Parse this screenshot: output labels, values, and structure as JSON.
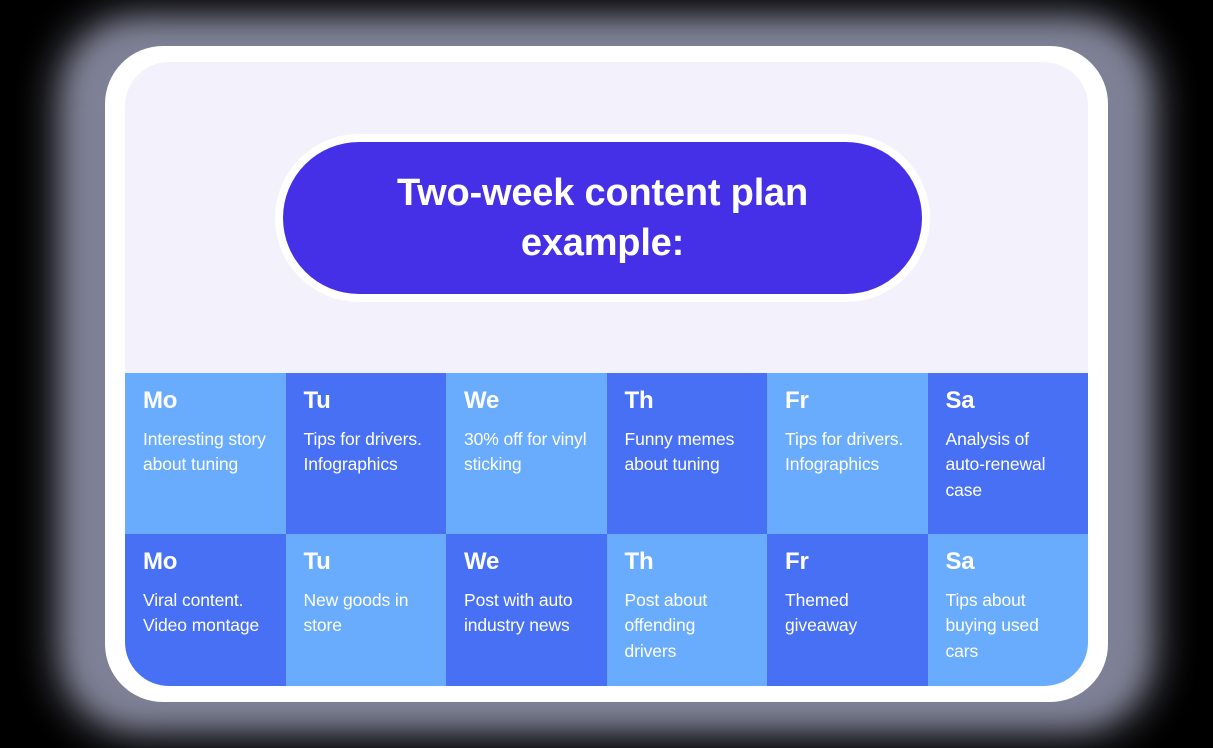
{
  "theme": {
    "canvas_background": "#000000",
    "shadow_ring": "#8c8fa3",
    "bezel": "#ffffff",
    "card_background": "#f3f2fc",
    "pill_background": "#4530e8",
    "cell_light": "#69acfd",
    "cell_dark": "#4770f4",
    "text_on_blue": "#ffffff"
  },
  "header": {
    "title": "Two-week content plan\nexample:"
  },
  "calendar": {
    "weeks": [
      {
        "days": [
          {
            "day": "Mo",
            "note": "Interesting story about tuning",
            "tone": "light"
          },
          {
            "day": "Tu",
            "note": "Tips for drivers. Infographics",
            "tone": "dark"
          },
          {
            "day": "We",
            "note": "30% off for vinyl sticking",
            "tone": "light"
          },
          {
            "day": "Th",
            "note": "Funny memes about tuning",
            "tone": "dark"
          },
          {
            "day": "Fr",
            "note": "Tips for drivers. Infographics",
            "tone": "light"
          },
          {
            "day": "Sa",
            "note": "Analysis of auto-renewal case",
            "tone": "dark"
          }
        ]
      },
      {
        "days": [
          {
            "day": "Mo",
            "note": "Viral content. Video montage",
            "tone": "dark"
          },
          {
            "day": "Tu",
            "note": "New goods in store",
            "tone": "light"
          },
          {
            "day": "We",
            "note": "Post with auto industry news",
            "tone": "dark"
          },
          {
            "day": "Th",
            "note": "Post about offending drivers",
            "tone": "light"
          },
          {
            "day": "Fr",
            "note": "Themed giveaway",
            "tone": "dark"
          },
          {
            "day": "Sa",
            "note": "Tips about buying used cars",
            "tone": "light"
          }
        ]
      }
    ]
  }
}
